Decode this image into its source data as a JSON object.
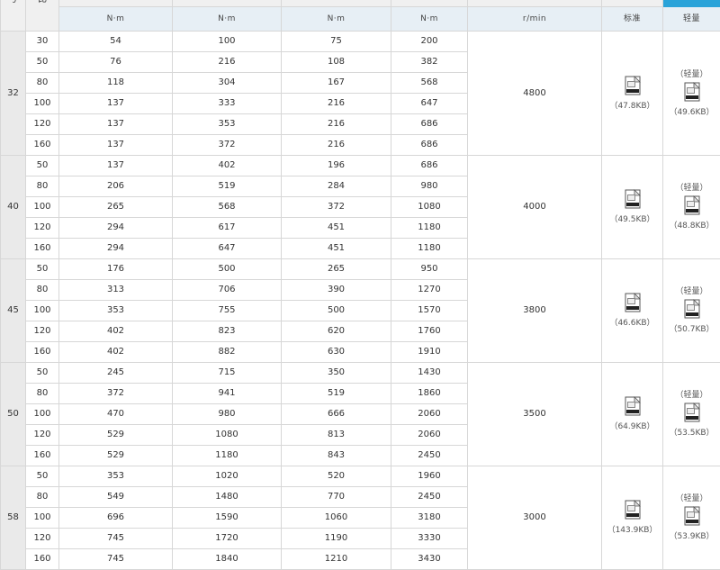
{
  "header": {
    "size_col": "号",
    "ratio_col": "比",
    "torque_unit": "N·m",
    "speed_unit": "r/min",
    "standard": "标准",
    "light": "轻量"
  },
  "light_label": "（轻量）",
  "icon": "cad-file-icon",
  "colors": {
    "header_bg": "#e7eff5",
    "size_bg": "#eaeaea",
    "grid": "#d7d7d7",
    "accent": "#29a3d9"
  },
  "groups": [
    {
      "size": "32",
      "speed": "4800",
      "standard_size": "（47.8KB）",
      "light_size": "（49.6KB）",
      "rows": [
        {
          "ratio": "30",
          "t1": "54",
          "t2": "100",
          "t3": "75",
          "t4": "200"
        },
        {
          "ratio": "50",
          "t1": "76",
          "t2": "216",
          "t3": "108",
          "t4": "382"
        },
        {
          "ratio": "80",
          "t1": "118",
          "t2": "304",
          "t3": "167",
          "t4": "568"
        },
        {
          "ratio": "100",
          "t1": "137",
          "t2": "333",
          "t3": "216",
          "t4": "647"
        },
        {
          "ratio": "120",
          "t1": "137",
          "t2": "353",
          "t3": "216",
          "t4": "686"
        },
        {
          "ratio": "160",
          "t1": "137",
          "t2": "372",
          "t3": "216",
          "t4": "686"
        }
      ]
    },
    {
      "size": "40",
      "speed": "4000",
      "standard_size": "（49.5KB）",
      "light_size": "（48.8KB）",
      "rows": [
        {
          "ratio": "50",
          "t1": "137",
          "t2": "402",
          "t3": "196",
          "t4": "686"
        },
        {
          "ratio": "80",
          "t1": "206",
          "t2": "519",
          "t3": "284",
          "t4": "980"
        },
        {
          "ratio": "100",
          "t1": "265",
          "t2": "568",
          "t3": "372",
          "t4": "1080"
        },
        {
          "ratio": "120",
          "t1": "294",
          "t2": "617",
          "t3": "451",
          "t4": "1180"
        },
        {
          "ratio": "160",
          "t1": "294",
          "t2": "647",
          "t3": "451",
          "t4": "1180"
        }
      ]
    },
    {
      "size": "45",
      "speed": "3800",
      "standard_size": "（46.6KB）",
      "light_size": "（50.7KB）",
      "rows": [
        {
          "ratio": "50",
          "t1": "176",
          "t2": "500",
          "t3": "265",
          "t4": "950"
        },
        {
          "ratio": "80",
          "t1": "313",
          "t2": "706",
          "t3": "390",
          "t4": "1270"
        },
        {
          "ratio": "100",
          "t1": "353",
          "t2": "755",
          "t3": "500",
          "t4": "1570"
        },
        {
          "ratio": "120",
          "t1": "402",
          "t2": "823",
          "t3": "620",
          "t4": "1760"
        },
        {
          "ratio": "160",
          "t1": "402",
          "t2": "882",
          "t3": "630",
          "t4": "1910"
        }
      ]
    },
    {
      "size": "50",
      "speed": "3500",
      "standard_size": "（64.9KB）",
      "light_size": "（53.5KB）",
      "rows": [
        {
          "ratio": "50",
          "t1": "245",
          "t2": "715",
          "t3": "350",
          "t4": "1430"
        },
        {
          "ratio": "80",
          "t1": "372",
          "t2": "941",
          "t3": "519",
          "t4": "1860"
        },
        {
          "ratio": "100",
          "t1": "470",
          "t2": "980",
          "t3": "666",
          "t4": "2060"
        },
        {
          "ratio": "120",
          "t1": "529",
          "t2": "1080",
          "t3": "813",
          "t4": "2060"
        },
        {
          "ratio": "160",
          "t1": "529",
          "t2": "1180",
          "t3": "843",
          "t4": "2450"
        }
      ]
    },
    {
      "size": "58",
      "speed": "3000",
      "standard_size": "（143.9KB）",
      "light_size": "（53.9KB）",
      "rows": [
        {
          "ratio": "50",
          "t1": "353",
          "t2": "1020",
          "t3": "520",
          "t4": "1960"
        },
        {
          "ratio": "80",
          "t1": "549",
          "t2": "1480",
          "t3": "770",
          "t4": "2450"
        },
        {
          "ratio": "100",
          "t1": "696",
          "t2": "1590",
          "t3": "1060",
          "t4": "3180"
        },
        {
          "ratio": "120",
          "t1": "745",
          "t2": "1720",
          "t3": "1190",
          "t4": "3330"
        },
        {
          "ratio": "160",
          "t1": "745",
          "t2": "1840",
          "t3": "1210",
          "t4": "3430"
        }
      ]
    }
  ]
}
